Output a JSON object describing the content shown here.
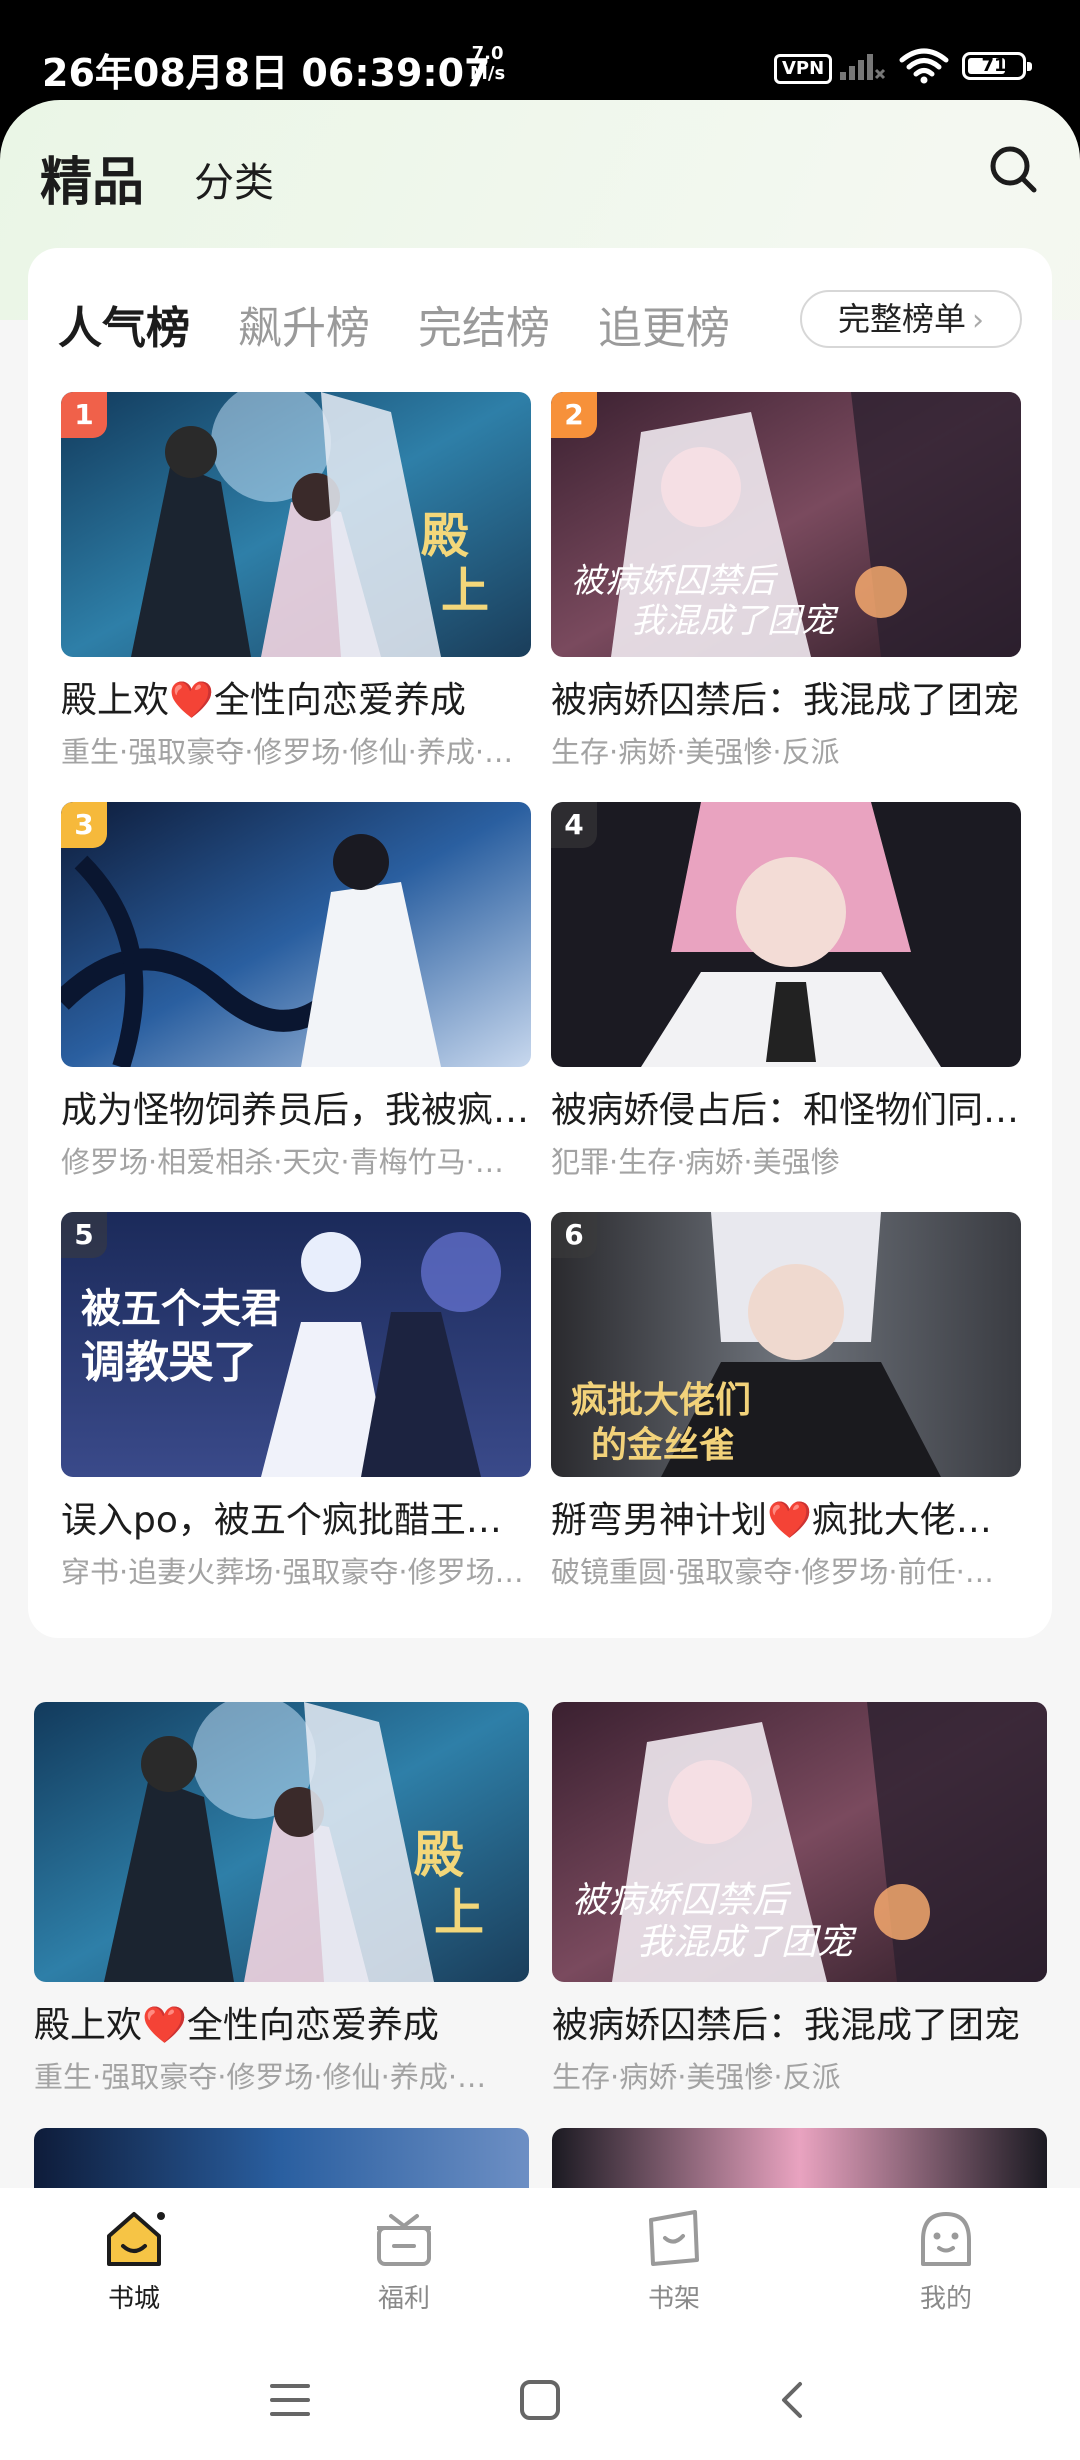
{
  "status_bar": {
    "time": "26年08月8日 06:39:07",
    "net_speed_value": "7.0",
    "net_speed_unit": "M/s",
    "vpn": "VPN",
    "battery": "71",
    "battery_level": 0.71,
    "icons": [
      "signal-icon",
      "wifi-icon",
      "battery-icon"
    ]
  },
  "header": {
    "tab_featured": "精品",
    "tab_category": "分类",
    "search_icon": "search-icon"
  },
  "ranking": {
    "tabs": [
      {
        "label": "人气榜",
        "active": true
      },
      {
        "label": "飙升榜",
        "active": false
      },
      {
        "label": "完结榜",
        "active": false
      },
      {
        "label": "追更榜",
        "active": false
      }
    ],
    "full_list_label": "完整榜单",
    "books": [
      {
        "rank": "1",
        "title": "殿上欢❤️全性向恋爱养成",
        "tags": "重生·强取豪夺·修罗场·修仙·养成·…",
        "badge_color": "#f0614a"
      },
      {
        "rank": "2",
        "title": "被病娇囚禁后：我混成了团宠",
        "tags": "生存·病娇·美强惨·反派",
        "badge_color": "#f7913a"
      },
      {
        "rank": "3",
        "title": "成为怪物饲养员后，我被疯批们盯上了",
        "tags": "修罗场·相爱相杀·天灾·青梅竹马·…",
        "badge_color": "#f6b93b"
      },
      {
        "rank": "4",
        "title": "被病娇侵占后：和怪物们同居的日子",
        "tags": "犯罪·生存·病娇·美强惨",
        "badge_color": "rgba(60,60,60,0.55)"
      },
      {
        "rank": "5",
        "title": "误入po，被五个疯批醋王调教哭了",
        "tags": "穿书·追妻火葬场·强取豪夺·修罗场·…",
        "badge_color": "rgba(60,60,60,0.55)"
      },
      {
        "rank": "6",
        "title": "掰弯男神计划❤️疯批大佬的金丝雀",
        "tags": "破镜重圆·强取豪夺·修罗场·前任·…",
        "badge_color": "rgba(60,60,60,0.55)"
      }
    ]
  },
  "feed": {
    "books": [
      {
        "title": "殿上欢❤️全性向恋爱养成",
        "tags": "重生·强取豪夺·修罗场·修仙·养成·…"
      },
      {
        "title": "被病娇囚禁后：我混成了团宠",
        "tags": "生存·病娇·美强惨·反派"
      }
    ]
  },
  "bottom_nav": [
    {
      "label": "书城",
      "icon": "bookstore-home-icon",
      "active": true
    },
    {
      "label": "福利",
      "icon": "gift-icon",
      "active": false
    },
    {
      "label": "书架",
      "icon": "bookshelf-icon",
      "active": false
    },
    {
      "label": "我的",
      "icon": "profile-face-icon",
      "active": false
    }
  ],
  "system_nav": [
    "menu-icon",
    "home-icon",
    "back-icon"
  ],
  "colors": {
    "accent": "#f6c445",
    "rank1": "#f0614a",
    "rank2": "#f7913a",
    "rank3": "#f6b93b"
  }
}
